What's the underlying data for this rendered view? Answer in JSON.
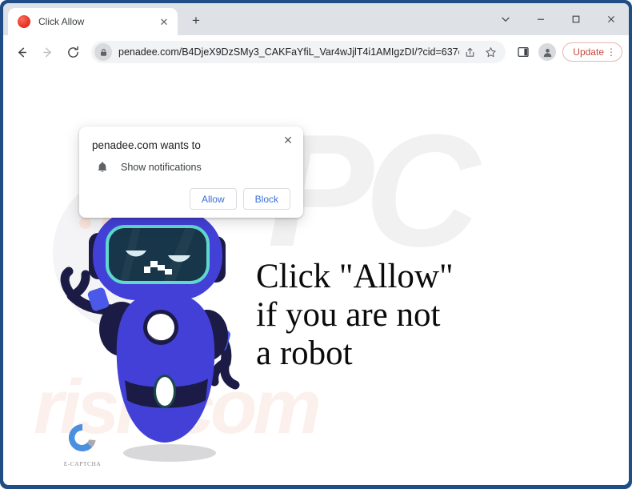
{
  "window": {
    "frame_color": "#1f4e86",
    "controls": {
      "tab_search_icon": "chevron-down-icon",
      "minimize_icon": "minimize-icon",
      "maximize_icon": "maximize-icon",
      "close_icon": "close-icon"
    }
  },
  "tabstrip": {
    "tabs": [
      {
        "title": "Click Allow",
        "favicon": "red-circle-favicon",
        "close_label": "✕"
      }
    ],
    "new_tab_label": "+"
  },
  "toolbar": {
    "back_icon": "back-arrow-icon",
    "forward_icon": "forward-arrow-icon",
    "reload_icon": "reload-icon",
    "lock_icon": "lock-icon",
    "url": "penadee.com/B4DjeX9DzSMy3_CAKFaYfiL_Var4wJjlT4i1AMIgzDI/?cid=637cf1543030...",
    "share_icon": "share-icon",
    "bookmark_icon": "star-icon",
    "side_panel_icon": "side-panel-icon",
    "profile_icon": "profile-avatar-icon",
    "update_label": "Update",
    "update_menu_label": "⋮",
    "update_color": "#c5493c"
  },
  "permission_dialog": {
    "title": "penadee.com wants to",
    "permission_icon": "bell-icon",
    "permission_label": "Show notifications",
    "allow_label": "Allow",
    "block_label": "Block",
    "close_label": "✕",
    "button_text_color": "#3b6fd4"
  },
  "page": {
    "headline": "Click \"Allow\"\nif you are not\na robot",
    "watermark_big": "PC",
    "watermark_small": "risk.com",
    "captcha_logo_label": "E-CAPTCHA",
    "robot_alt": "sleepy blue robot waving",
    "colors": {
      "robot_body": "#4340d8",
      "robot_dark": "#1b1b46",
      "visor_border": "#5fd8cf",
      "visor_fill": "#17364a",
      "accent_blue": "#4a59e8"
    }
  }
}
